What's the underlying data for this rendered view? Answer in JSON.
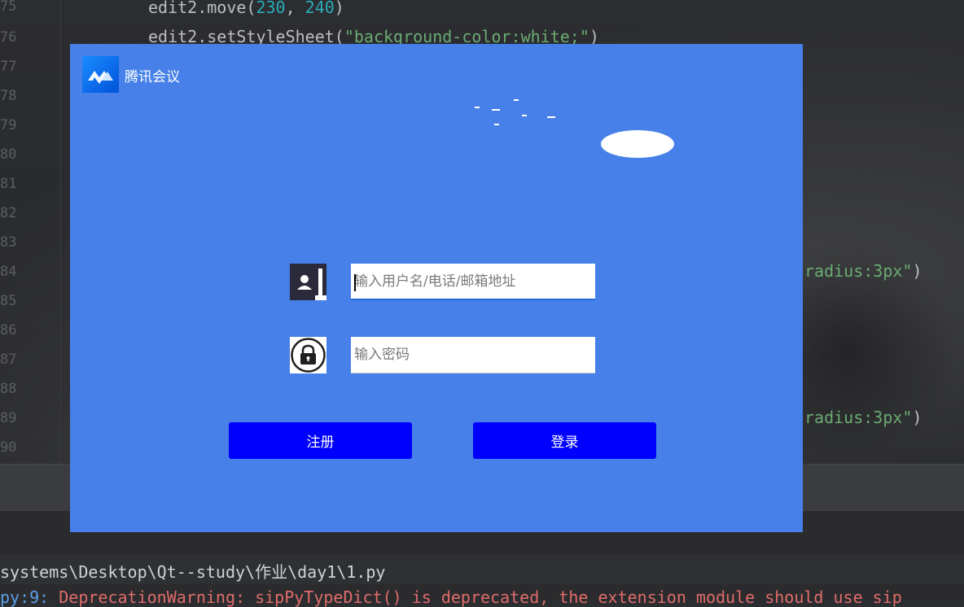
{
  "ide": {
    "line_numbers": [
      "75",
      "76",
      "77",
      "78",
      "79",
      "80",
      "81",
      "82",
      "83",
      "84",
      "85",
      "86",
      "87",
      "88",
      "89",
      "90"
    ],
    "code": {
      "line1_call": "edit2.move(",
      "line1_arg1": "230",
      "line1_sep": ", ",
      "line1_arg2": "240",
      "line1_end": ")",
      "line2_call": "edit2.setStyleSheet(",
      "line2_str": "\"background-color:white;\"",
      "line2_end": ")",
      "right_str_1": "radius:3px\"",
      "right_end_1": ")",
      "right_str_2": "radius:3px\"",
      "right_end_2": ")"
    },
    "console": {
      "path": "systems\\Desktop\\Qt--study\\作业\\day1\\1.py",
      "warning_prefix": "py:9: ",
      "warning": "DeprecationWarning: sipPyTypeDict() is deprecated, the extension module should use sip"
    }
  },
  "app": {
    "title": "腾讯会议",
    "logo_icon": "tencent-meeting-logo-icon",
    "username_icon": "user-icon",
    "password_icon": "lock-icon",
    "username_placeholder": "输入用户名/电话/邮箱地址",
    "password_placeholder": "输入密码",
    "register_label": "注册",
    "login_label": "登录",
    "colors": {
      "window_bg": "#4680e8",
      "button_bg": "#0000ff",
      "button_text": "#ffffff"
    }
  }
}
